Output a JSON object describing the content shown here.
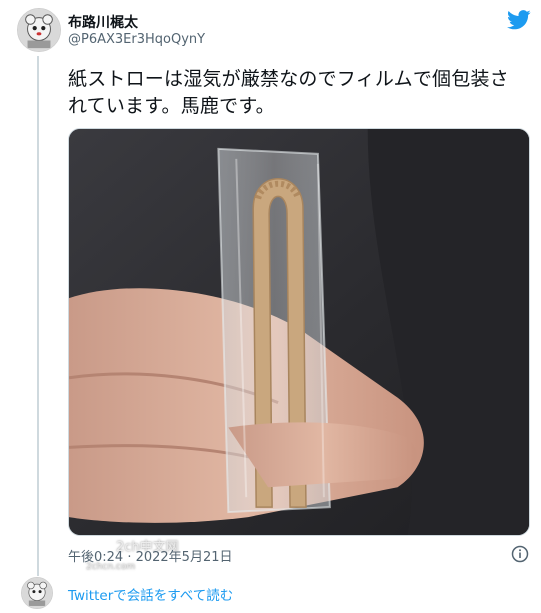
{
  "author": {
    "display_name": "布路川梶太",
    "handle": "@P6AX3Er3HqoQynY",
    "avatar_icon": "profile-avatar-icon"
  },
  "tweet": {
    "text": "紙ストローは湿気が厳禁なのでフィルムで個包装されています。馬鹿です。",
    "timestamp": "午後0:24 · 2022年5月21日"
  },
  "photo": {
    "subject": "paper-straw-in-plastic-wrap"
  },
  "watermark": {
    "text": "2ch中文网",
    "sub": "2chcn.com"
  },
  "footer": {
    "link_label": "Twitterで会話をすべて読む"
  },
  "icons": {
    "brand": "twitter-bird-icon",
    "info": "info-icon"
  },
  "colors": {
    "accent": "#1d9bf0",
    "text": "#0f1419",
    "secondary": "#536471",
    "border": "#cfd9de"
  }
}
